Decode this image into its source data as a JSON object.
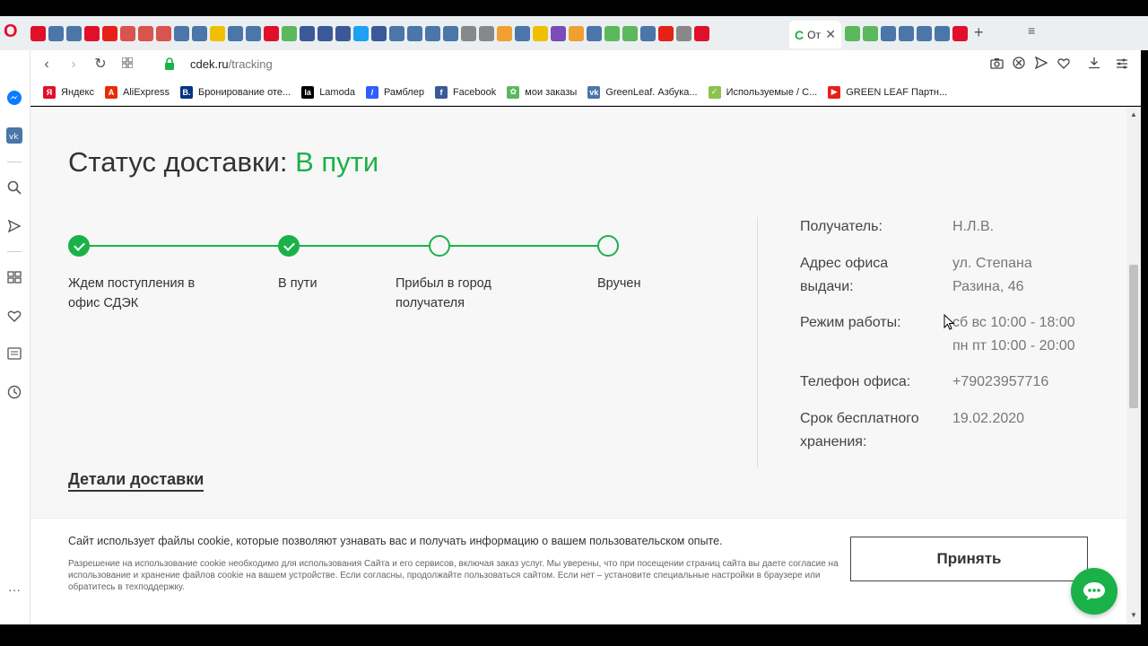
{
  "browser": {
    "active_tab_title": "От",
    "url_domain": "cdek.ru",
    "url_path": "/tracking",
    "new_tab": "+",
    "opera_logo": "O"
  },
  "bookmarks": [
    {
      "label": "Яндекс",
      "icon": "yandex-icon",
      "color": "#e0102a",
      "glyph": "Я"
    },
    {
      "label": "AliExpress",
      "icon": "aliexpress-icon",
      "color": "#e62e04",
      "glyph": "A"
    },
    {
      "label": "Бронирование оте...",
      "icon": "booking-icon",
      "color": "#003580",
      "glyph": "B."
    },
    {
      "label": "Lamoda",
      "icon": "lamoda-icon",
      "color": "#000000",
      "glyph": "la"
    },
    {
      "label": "Рамблер",
      "icon": "rambler-icon",
      "color": "#315efb",
      "glyph": "/"
    },
    {
      "label": "Facebook",
      "icon": "facebook-icon",
      "color": "#3b5998",
      "glyph": "f"
    },
    {
      "label": "мои заказы",
      "icon": "greenleaf-icon",
      "color": "#5cb85c",
      "glyph": "✿"
    },
    {
      "label": "GreenLeaf. Азбука...",
      "icon": "vk-icon",
      "color": "#4a76a8",
      "glyph": "vk"
    },
    {
      "label": "Используемые / С...",
      "icon": "leaf-icon",
      "color": "#8bc34a",
      "glyph": "✓"
    },
    {
      "label": "GREEN LEAF Партн...",
      "icon": "youtube-icon",
      "color": "#e62117",
      "glyph": "▶"
    }
  ],
  "status": {
    "prefix": "Статус доставки: ",
    "value": "В пути",
    "accent": "#1ab248"
  },
  "timeline": [
    {
      "label": "Ждем поступления в офис СДЭК",
      "done": true
    },
    {
      "label": "В пути",
      "done": true
    },
    {
      "label": "Прибыл в город получателя",
      "done": false
    },
    {
      "label": "Вручен",
      "done": false
    }
  ],
  "info": {
    "recipient_label": "Получатель:",
    "recipient_value": "Н.Л.В.",
    "address_label_1": "Адрес офиса",
    "address_label_2": "выдачи:",
    "address_value_1": "ул. Степана",
    "address_value_2": "Разина, 46",
    "hours_label": "Режим работы:",
    "hours_value_1": "сб вс 10:00 - 18:00",
    "hours_value_2": "пн пт 10:00 - 20:00",
    "phone_label": "Телефон офиса:",
    "phone_value": "+79023957716",
    "storage_label_1": "Срок бесплатного",
    "storage_label_2": "хранения:",
    "storage_value": "19.02.2020"
  },
  "details_link": "Детали доставки",
  "cookie": {
    "main": "Сайт использует файлы cookie, которые позволяют узнавать вас и получать информацию о вашем пользовательском опыте.",
    "small": "Разрешение на использование cookie необходимо для использования Сайта и его сервисов, включая заказ услуг. Мы уверены, что при посещении страниц сайта вы даете согласие на использование и хранение файлов cookie на вашем устройстве. Если согласны, продолжайте пользоваться сайтом. Если нет – установите специальные настройки в браузере или обратитесь в техподдержку.",
    "accept": "Принять"
  }
}
